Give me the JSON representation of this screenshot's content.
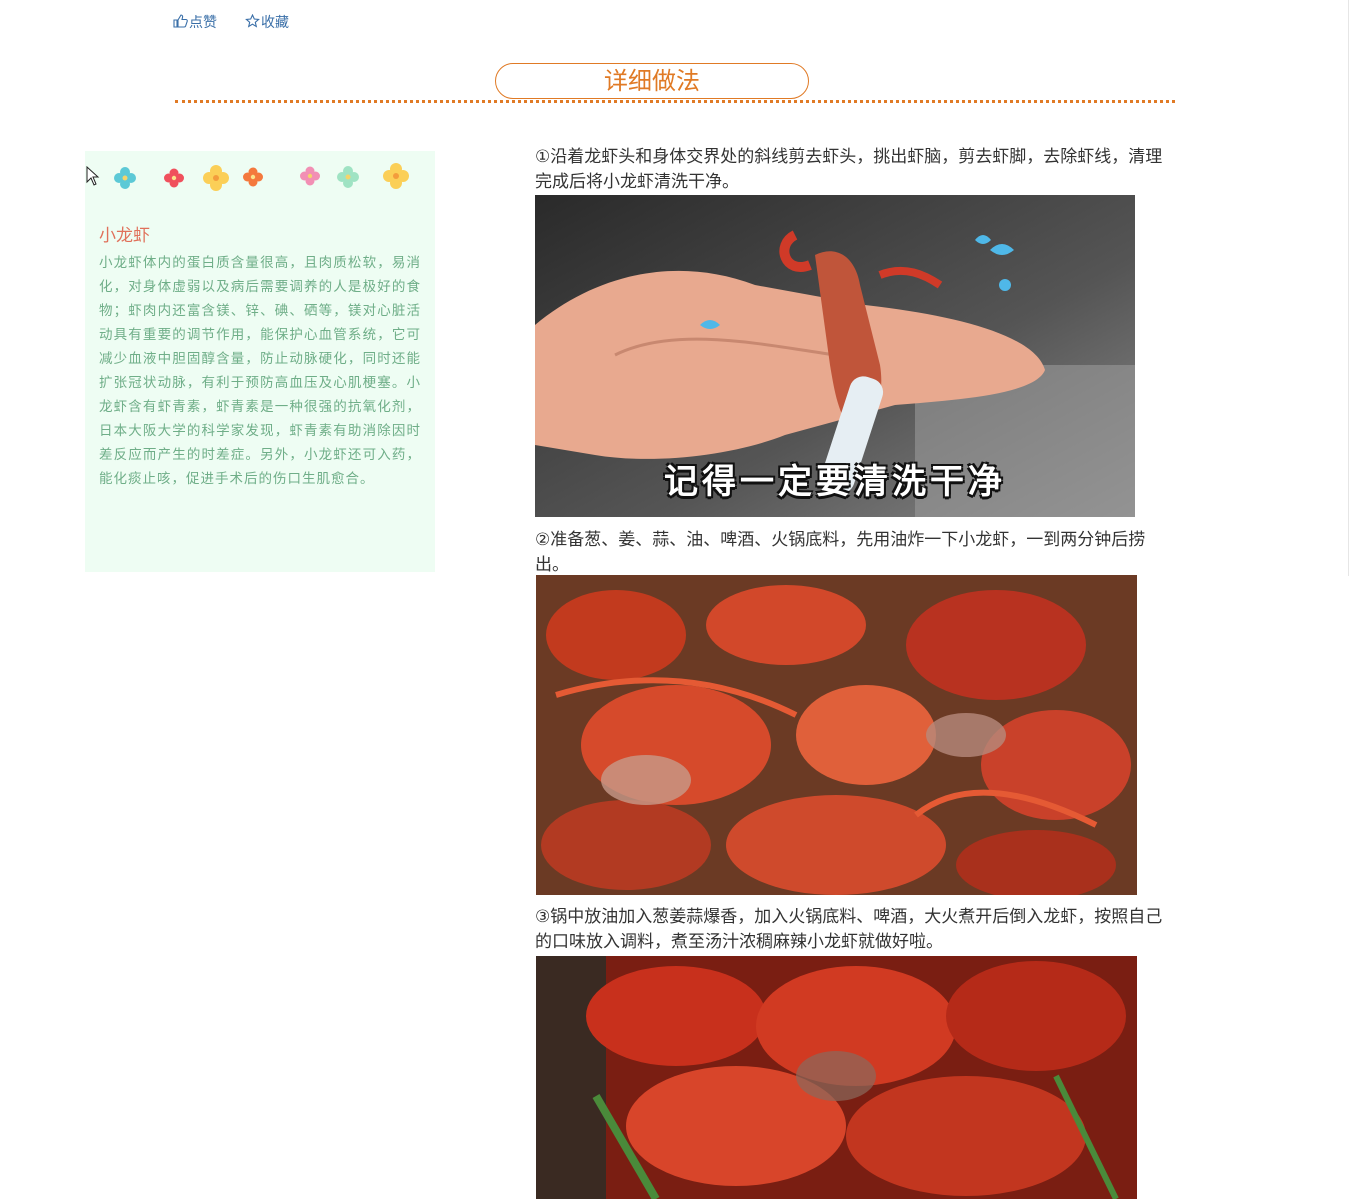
{
  "actions": {
    "like_icon": "thumbs-up-icon",
    "like_label": "点赞",
    "favorite_icon": "star-icon",
    "favorite_label": "收藏"
  },
  "section": {
    "title": "详细做法"
  },
  "colors": {
    "accent": "#e07a25",
    "card_bg": "#eefdf3",
    "card_title": "#e0705a",
    "card_text": "#6fae88",
    "link": "#3a6fa8"
  },
  "info_card": {
    "title": "小龙虾",
    "body": "小龙虾体内的蛋白质含量很高，且肉质松软，易消化，对身体虚弱以及病后需要调养的人是极好的食物；虾肉内还富含镁、锌、碘、硒等，镁对心脏活动具有重要的调节作用，能保护心血管系统，它可减少血液中胆固醇含量，防止动脉硬化，同时还能扩张冠状动脉，有利于预防高血压及心肌梗塞。小龙虾含有虾青素，虾青素是一种很强的抗氧化剂，日本大阪大学的科学家发现，虾青素有助消除因时差反应而产生的时差症。另外，小龙虾还可入药，能化痰止咳，促进手术后的伤口生肌愈合。"
  },
  "steps": [
    {
      "text": "①沿着龙虾头和身体交界处的斜线剪去虾头，挑出虾脑，剪去虾脚，去除虾线，清理完成后将小龙虾清洗干净。",
      "image_caption": "记得一定要清洗干净"
    },
    {
      "text": "  ②准备葱、姜、蒜、油、啤酒、火锅底料，先用油炸一下小龙虾，一到两分钟后捞出。"
    },
    {
      "text": "  ③锅中放油加入葱姜蒜爆香，加入火锅底料、啤酒，大火煮开后倒入龙虾，按照自己的口味放入调料，煮至汤汁浓稠麻辣小龙虾就做好啦。"
    }
  ]
}
